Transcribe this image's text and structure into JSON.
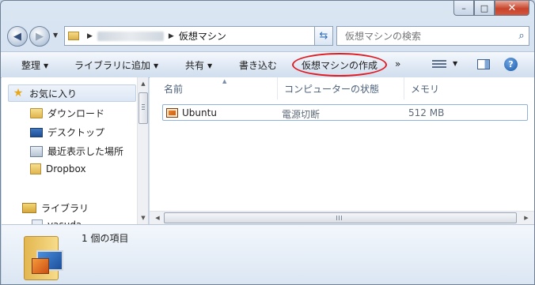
{
  "window": {
    "caption": {
      "minimize": "–",
      "maximize": "□",
      "close": "✕"
    }
  },
  "address_bar": {
    "crumb": "仮想マシン",
    "search_placeholder": "仮想マシンの検索"
  },
  "toolbar": {
    "organize": "整理",
    "add_to_library": "ライブラリに追加",
    "share": "共有",
    "burn": "書き込む",
    "create_vm": "仮想マシンの作成",
    "more": "»",
    "highlight_color": "#e01b24"
  },
  "nav_pane": {
    "favorites": "お気に入り",
    "items": [
      {
        "label": "ダウンロード",
        "icon": "download-folder-icon"
      },
      {
        "label": "デスクトップ",
        "icon": "desktop-icon"
      },
      {
        "label": "最近表示した場所",
        "icon": "recent-places-icon"
      },
      {
        "label": "Dropbox",
        "icon": "dropbox-folder-icon"
      }
    ],
    "libraries": "ライブラリ",
    "partial_item": "yasuda"
  },
  "columns": {
    "name": "名前",
    "state": "コンピューターの状態",
    "memory": "メモリ"
  },
  "files": [
    {
      "name": "Ubuntu",
      "state": "電源切断",
      "memory": "512 MB",
      "icon": "virtual-machine-icon"
    }
  ],
  "details": {
    "count_text": "1 個の項目"
  }
}
